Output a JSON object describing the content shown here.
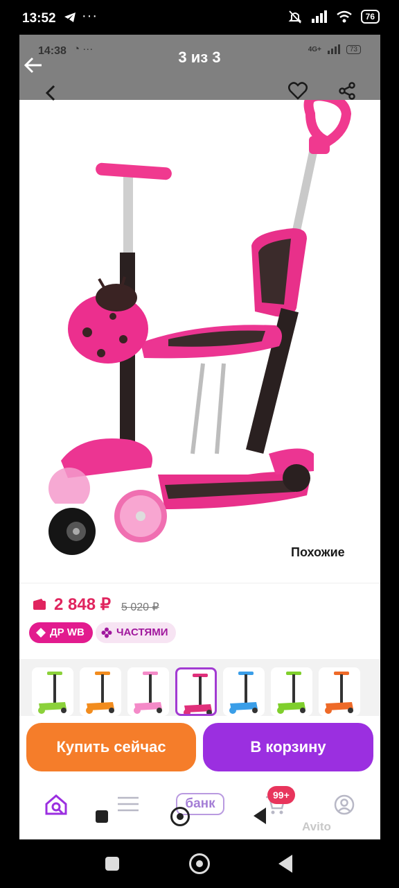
{
  "outer_status": {
    "time": "13:52",
    "battery": "76"
  },
  "viewer": {
    "title": "3 из 3"
  },
  "inner_status": {
    "time": "14:38",
    "network": "4G+",
    "battery": "73"
  },
  "product": {
    "similar_label": "Похожие",
    "price": "2 848 ₽",
    "old_price": "5 020 ₽",
    "badges": {
      "wb": "ДР WB",
      "parts": "ЧАСТЯМИ"
    },
    "thumbnail_colors": [
      "#8bd13a",
      "#f28c1e",
      "#f48ac8",
      "#e0307b",
      "#3a9ee8",
      "#7fcf2c",
      "#ee6a28"
    ],
    "selected_thumbnail": 3,
    "accent_color": "#e0245e"
  },
  "actions": {
    "buy_now": "Купить сейчас",
    "to_cart": "В корзину"
  },
  "app_nav": {
    "bank": "банк",
    "cart_count": "99+"
  },
  "watermark": "Avito"
}
